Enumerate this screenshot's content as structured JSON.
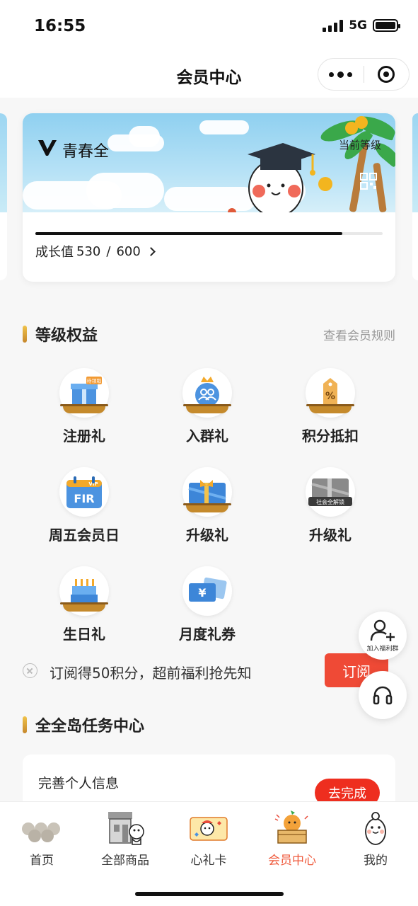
{
  "status_bar": {
    "time": "16:55",
    "network": "5G"
  },
  "nav": {
    "title": "会员中心"
  },
  "member_card": {
    "level_name": "青春全",
    "current_level_label": "当前等级",
    "growth_label": "成长值",
    "growth_value": "530",
    "growth_separator": "/",
    "growth_target": "600",
    "progress_fraction": 0.883
  },
  "benefits_section": {
    "title": "等级权益",
    "rules_link": "查看会员规则",
    "items": [
      {
        "label": "注册礼",
        "icon": "gift-box-icon",
        "badge": "待领取"
      },
      {
        "label": "入群礼",
        "icon": "group-crown-icon"
      },
      {
        "label": "积分抵扣",
        "icon": "discount-tag-icon"
      },
      {
        "label": "周五会员日",
        "icon": "vip-calendar-icon",
        "badge": "VIP",
        "calendar_text": "FIR"
      },
      {
        "label": "升级礼",
        "icon": "blue-gift-card-icon"
      },
      {
        "label": "升级礼",
        "icon": "locked-gift-card-icon",
        "badge": "社会全解锁"
      },
      {
        "label": "生日礼",
        "icon": "birthday-cake-icon"
      },
      {
        "label": "月度礼券",
        "icon": "coupon-icon",
        "coupon_symbol": "¥"
      }
    ]
  },
  "subscribe": {
    "text": "订阅得50积分，超前福利抢先知",
    "button": "订阅"
  },
  "floating": {
    "join_group_label": "加入福利群"
  },
  "task_section": {
    "title": "全全岛任务中心",
    "task_title": "完善个人信息",
    "task_button": "去完成"
  },
  "tab_bar": {
    "items": [
      {
        "label": "首页",
        "icon": "home-icon"
      },
      {
        "label": "全部商品",
        "icon": "shop-icon"
      },
      {
        "label": "心礼卡",
        "icon": "gift-card-icon"
      },
      {
        "label": "会员中心",
        "icon": "member-center-icon",
        "active": true
      },
      {
        "label": "我的",
        "icon": "profile-icon"
      }
    ]
  },
  "colors": {
    "accent_red": "#ef4a36",
    "active_tab": "#ef5a3c",
    "section_bar": "#c6872c",
    "sky": "#8fd0f0"
  }
}
